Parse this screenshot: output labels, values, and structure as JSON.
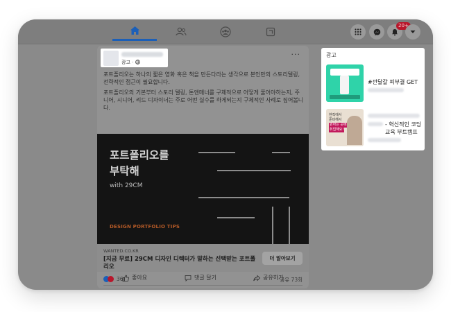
{
  "nav": {
    "tabs": [
      {
        "name": "home",
        "active": true
      },
      {
        "name": "friends",
        "active": false
      },
      {
        "name": "groups",
        "active": false
      },
      {
        "name": "gaming",
        "active": false
      }
    ],
    "notification_badge": "20+",
    "accent_color": "#1b5fb8"
  },
  "post": {
    "sponsored_label": "광고 · ",
    "more_label": "···",
    "paragraph1": "포트폴리오는 하나의 짧은 영화 혹은 책을 만든다라는 생각으로 본인만의 스토리텔링, 전략적인 접근이 필요합니다.",
    "paragraph2": "포트폴리오의 기본부터 스토리 텔링, 톤앤매너를 구체적으로 어떻게 풀어야하는지, 주니어, 시니어, 리드 디자이너는 주로 어떤 실수를 하게되는지 구체적인 사례로 짚어봅니다.",
    "image": {
      "title": "포트폴리오를\n부탁해",
      "subtitle": "with 29CM",
      "tips": "DESIGN PORTFOLIO TIPS"
    },
    "link": {
      "domain": "WANTED.CO.KR",
      "title": "[지금 무료] 29CM 디자인 디렉터가 말하는 선택받는 포트폴리오",
      "button": "더 알아보기"
    },
    "reaction_count": "36",
    "share_count": "공유 73회",
    "actions": {
      "like": "좋아요",
      "comment": "댓글 달기",
      "share": "공유하기"
    }
  },
  "ads": {
    "title": "광고",
    "items": [
      {
        "text": "#깐달걀 피부결 GET"
      },
      {
        "text": "- 혁신적인 코딩 교육 부트캠프"
      }
    ],
    "ad2_thumb_lines": [
      "현직에서",
      "준비해서",
      "원하는 곳에",
      "취업해요!"
    ]
  }
}
